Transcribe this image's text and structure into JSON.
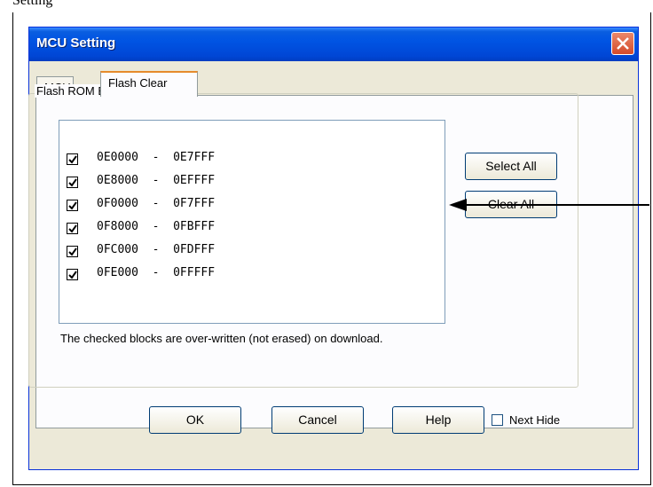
{
  "document": {
    "heading_fragment": "Setting"
  },
  "window": {
    "title": "MCU Setting"
  },
  "tabs": [
    {
      "label": "MCU",
      "active": false
    },
    {
      "label": "Flash Clear",
      "active": true
    }
  ],
  "group": {
    "label": "Flash ROM Block"
  },
  "blocks": [
    {
      "start": "0E0000",
      "end": "0E7FFF",
      "checked": true
    },
    {
      "start": "0E8000",
      "end": "0EFFFF",
      "checked": true
    },
    {
      "start": "0F0000",
      "end": "0F7FFF",
      "checked": true
    },
    {
      "start": "0F8000",
      "end": "0FBFFF",
      "checked": true
    },
    {
      "start": "0FC000",
      "end": "0FDFFF",
      "checked": true
    },
    {
      "start": "0FE000",
      "end": "0FFFFF",
      "checked": true
    }
  ],
  "buttons": {
    "select_all": "Select All",
    "clear_all": "Clear All",
    "ok": "OK",
    "cancel": "Cancel",
    "help": "Help"
  },
  "note": "The checked blocks are over-written (not erased) on download.",
  "next_hide": {
    "label": "Next Hide",
    "checked": false
  },
  "colors": {
    "titlebar": "#0054e3",
    "dialog_bg": "#ece9d8",
    "close_btn": "#d54a2a"
  }
}
